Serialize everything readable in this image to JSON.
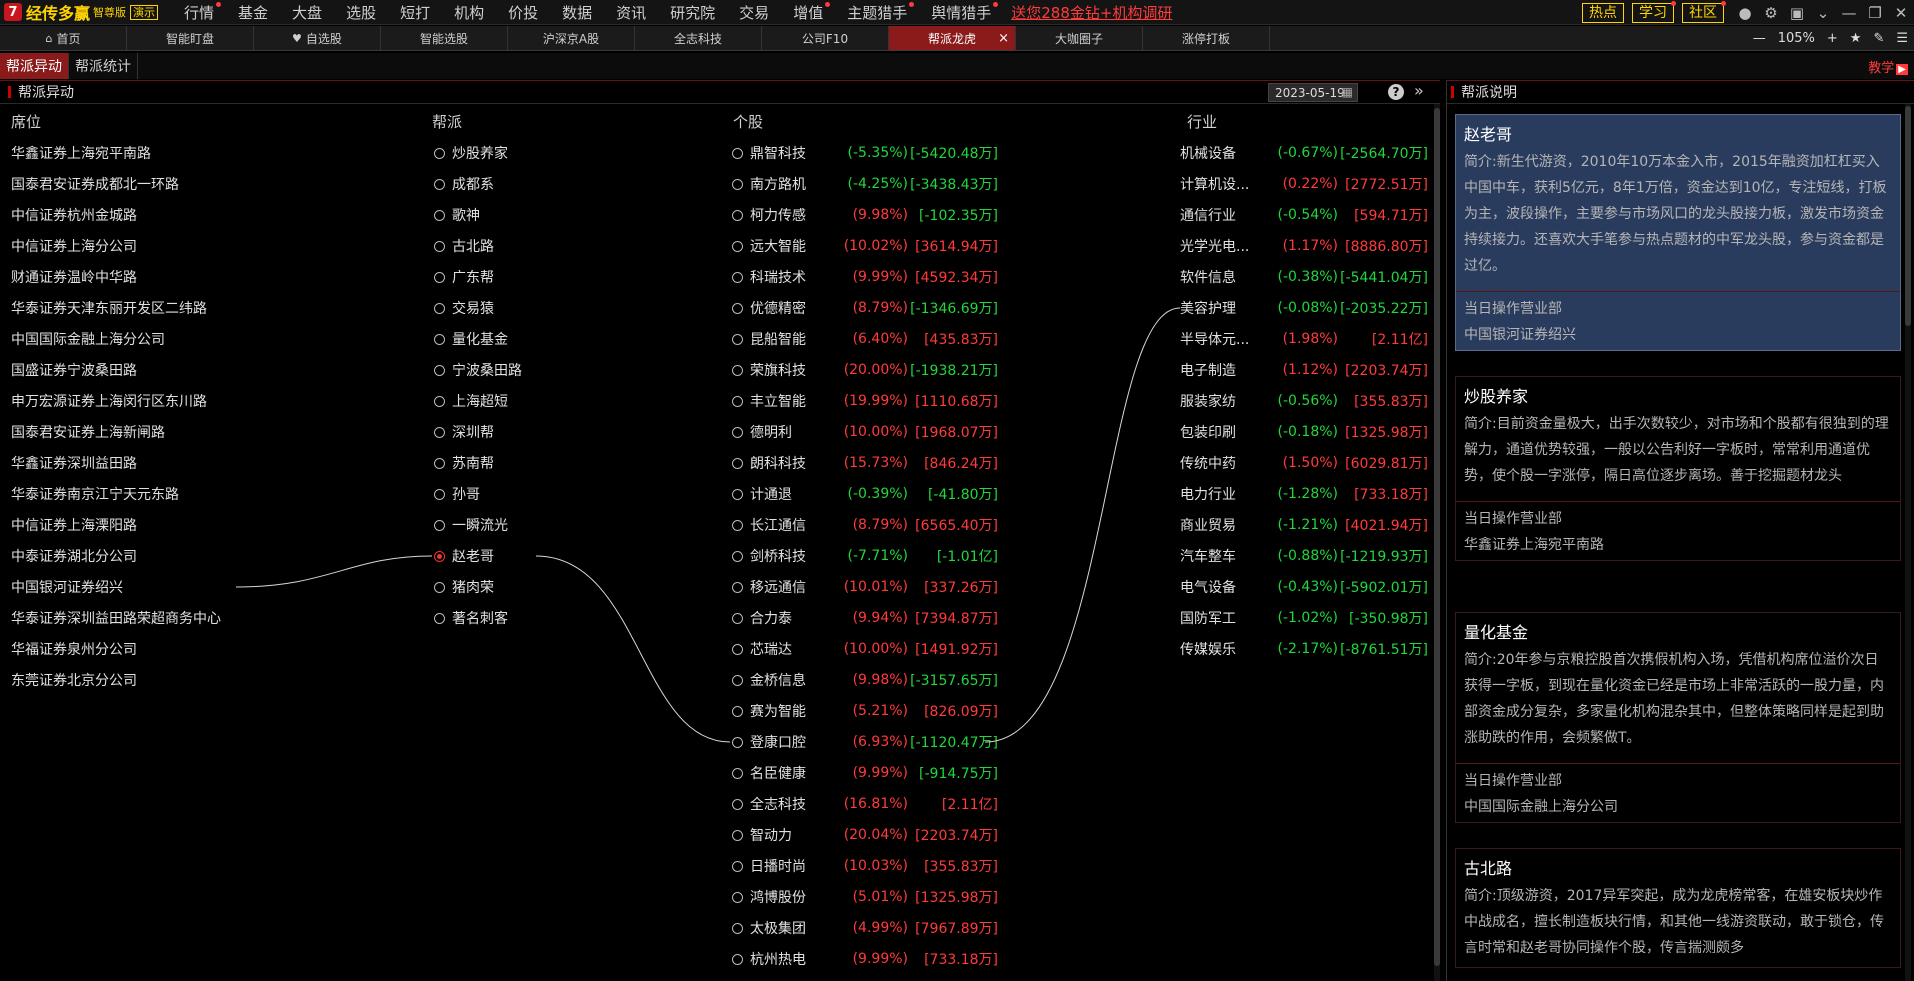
{
  "app": {
    "logo_mark": "7",
    "logo_text": "经传多赢",
    "logo_version": "智尊版",
    "logo_demo": "演示"
  },
  "menu": [
    {
      "label": "行情",
      "dot": true
    },
    {
      "label": "基金",
      "dot": false
    },
    {
      "label": "大盘",
      "dot": false
    },
    {
      "label": "选股",
      "dot": false
    },
    {
      "label": "短打",
      "dot": false
    },
    {
      "label": "机构",
      "dot": false
    },
    {
      "label": "价投",
      "dot": false
    },
    {
      "label": "数据",
      "dot": false
    },
    {
      "label": "资讯",
      "dot": false
    },
    {
      "label": "研究院",
      "dot": false
    },
    {
      "label": "交易",
      "dot": false
    },
    {
      "label": "增值",
      "dot": true
    },
    {
      "label": "主题猎手",
      "dot": true
    },
    {
      "label": "舆情猎手",
      "dot": true
    }
  ],
  "promo": "送您288金钻+机构调研",
  "top_buttons": [
    "热点",
    "学习",
    "社区"
  ],
  "tabs": [
    {
      "label": "首页",
      "icon": "home-icon"
    },
    {
      "label": "智能盯盘"
    },
    {
      "label": "自选股",
      "icon": "heart-icon"
    },
    {
      "label": "智能选股"
    },
    {
      "label": "沪深京A股"
    },
    {
      "label": "全志科技"
    },
    {
      "label": "公司F10"
    },
    {
      "label": "帮派龙虎",
      "active": true
    },
    {
      "label": "大咖圈子"
    },
    {
      "label": "涨停打板"
    }
  ],
  "zoom": "105%",
  "subtabs": [
    "帮派异动",
    "帮派统计"
  ],
  "teach_label": "教学",
  "panel": {
    "title": "帮派异动",
    "date": "2023-05-19"
  },
  "columns": {
    "seat": "席位",
    "gang": "帮派",
    "stock": "个股",
    "industry": "行业"
  },
  "seats": [
    "华鑫证券上海宛平南路",
    "国泰君安证券成都北一环路",
    "中信证券杭州金城路",
    "中信证券上海分公司",
    "财通证券温岭中华路",
    "华泰证券天津东丽开发区二纬路",
    "中国国际金融上海分公司",
    "国盛证券宁波桑田路",
    "申万宏源证券上海闵行区东川路",
    "国泰君安证券上海新闸路",
    "华鑫证券深圳益田路",
    "华泰证券南京江宁天元东路",
    "中信证券上海溧阳路",
    "中泰证券湖北分公司",
    "中国银河证券绍兴",
    "华泰证券深圳益田路荣超商务中心",
    "华福证券泉州分公司",
    "东莞证券北京分公司"
  ],
  "gangs": [
    {
      "name": "炒股养家",
      "selected": false
    },
    {
      "name": "成都系",
      "selected": false
    },
    {
      "name": "歌神",
      "selected": false
    },
    {
      "name": "古北路",
      "selected": false
    },
    {
      "name": "广东帮",
      "selected": false
    },
    {
      "name": "交易猿",
      "selected": false
    },
    {
      "name": "量化基金",
      "selected": false
    },
    {
      "name": "宁波桑田路",
      "selected": false
    },
    {
      "name": "上海超短",
      "selected": false
    },
    {
      "name": "深圳帮",
      "selected": false
    },
    {
      "name": "苏南帮",
      "selected": false
    },
    {
      "name": "孙哥",
      "selected": false
    },
    {
      "name": "一瞬流光",
      "selected": false
    },
    {
      "name": "赵老哥",
      "selected": true
    },
    {
      "name": "猪肉荣",
      "selected": false
    },
    {
      "name": "著名刺客",
      "selected": false
    }
  ],
  "stocks": [
    {
      "name": "鼎智科技",
      "pct": "(-5.35%)",
      "amt": "[-5420.48万]",
      "pct_up": false,
      "amt_up": false
    },
    {
      "name": "南方路机",
      "pct": "(-4.25%)",
      "amt": "[-3438.43万]",
      "pct_up": false,
      "amt_up": false
    },
    {
      "name": "柯力传感",
      "pct": "(9.98%)",
      "amt": "[-102.35万]",
      "pct_up": true,
      "amt_up": false
    },
    {
      "name": "远大智能",
      "pct": "(10.02%)",
      "amt": "[3614.94万]",
      "pct_up": true,
      "amt_up": true
    },
    {
      "name": "科瑞技术",
      "pct": "(9.99%)",
      "amt": "[4592.34万]",
      "pct_up": true,
      "amt_up": true
    },
    {
      "name": "优德精密",
      "pct": "(8.79%)",
      "amt": "[-1346.69万]",
      "pct_up": true,
      "amt_up": false
    },
    {
      "name": "昆船智能",
      "pct": "(6.40%)",
      "amt": "[435.83万]",
      "pct_up": true,
      "amt_up": true
    },
    {
      "name": "荣旗科技",
      "pct": "(20.00%)",
      "amt": "[-1938.21万]",
      "pct_up": true,
      "amt_up": false
    },
    {
      "name": "丰立智能",
      "pct": "(19.99%)",
      "amt": "[1110.68万]",
      "pct_up": true,
      "amt_up": true
    },
    {
      "name": "德明利",
      "pct": "(10.00%)",
      "amt": "[1968.07万]",
      "pct_up": true,
      "amt_up": true
    },
    {
      "name": "朗科科技",
      "pct": "(15.73%)",
      "amt": "[846.24万]",
      "pct_up": true,
      "amt_up": true
    },
    {
      "name": "计通退",
      "pct": "(-0.39%)",
      "amt": "[-41.80万]",
      "pct_up": false,
      "amt_up": false
    },
    {
      "name": "长江通信",
      "pct": "(8.79%)",
      "amt": "[6565.40万]",
      "pct_up": true,
      "amt_up": true
    },
    {
      "name": "剑桥科技",
      "pct": "(-7.71%)",
      "amt": "[-1.01亿]",
      "pct_up": false,
      "amt_up": false
    },
    {
      "name": "移远通信",
      "pct": "(10.01%)",
      "amt": "[337.26万]",
      "pct_up": true,
      "amt_up": true
    },
    {
      "name": "合力泰",
      "pct": "(9.94%)",
      "amt": "[7394.87万]",
      "pct_up": true,
      "amt_up": true
    },
    {
      "name": "芯瑞达",
      "pct": "(10.00%)",
      "amt": "[1491.92万]",
      "pct_up": true,
      "amt_up": true
    },
    {
      "name": "金桥信息",
      "pct": "(9.98%)",
      "amt": "[-3157.65万]",
      "pct_up": true,
      "amt_up": false
    },
    {
      "name": "赛为智能",
      "pct": "(5.21%)",
      "amt": "[826.09万]",
      "pct_up": true,
      "amt_up": true
    },
    {
      "name": "登康口腔",
      "pct": "(6.93%)",
      "amt": "[-1120.47万]",
      "pct_up": true,
      "amt_up": false
    },
    {
      "name": "名臣健康",
      "pct": "(9.99%)",
      "amt": "[-914.75万]",
      "pct_up": true,
      "amt_up": false
    },
    {
      "name": "全志科技",
      "pct": "(16.81%)",
      "amt": "[2.11亿]",
      "pct_up": true,
      "amt_up": true
    },
    {
      "name": "智动力",
      "pct": "(20.04%)",
      "amt": "[2203.74万]",
      "pct_up": true,
      "amt_up": true
    },
    {
      "name": "日播时尚",
      "pct": "(10.03%)",
      "amt": "[355.83万]",
      "pct_up": true,
      "amt_up": true
    },
    {
      "name": "鸿博股份",
      "pct": "(5.01%)",
      "amt": "[1325.98万]",
      "pct_up": true,
      "amt_up": true
    },
    {
      "name": "太极集团",
      "pct": "(4.99%)",
      "amt": "[7967.89万]",
      "pct_up": true,
      "amt_up": true
    },
    {
      "name": "杭州热电",
      "pct": "(9.99%)",
      "amt": "[733.18万]",
      "pct_up": true,
      "amt_up": true
    }
  ],
  "industries": [
    {
      "name": "机械设备",
      "pct": "(-0.67%)",
      "amt": "[-2564.70万]",
      "pct_up": false,
      "amt_up": false
    },
    {
      "name": "计算机设...",
      "pct": "(0.22%)",
      "amt": "[2772.51万]",
      "pct_up": true,
      "amt_up": true
    },
    {
      "name": "通信行业",
      "pct": "(-0.54%)",
      "amt": "[594.71万]",
      "pct_up": false,
      "amt_up": true
    },
    {
      "name": "光学光电...",
      "pct": "(1.17%)",
      "amt": "[8886.80万]",
      "pct_up": true,
      "amt_up": true
    },
    {
      "name": "软件信息",
      "pct": "(-0.38%)",
      "amt": "[-5441.04万]",
      "pct_up": false,
      "amt_up": false
    },
    {
      "name": "美容护理",
      "pct": "(-0.08%)",
      "amt": "[-2035.22万]",
      "pct_up": false,
      "amt_up": false
    },
    {
      "name": "半导体元...",
      "pct": "(1.98%)",
      "amt": "[2.11亿]",
      "pct_up": true,
      "amt_up": true
    },
    {
      "name": "电子制造",
      "pct": "(1.12%)",
      "amt": "[2203.74万]",
      "pct_up": true,
      "amt_up": true
    },
    {
      "name": "服装家纺",
      "pct": "(-0.56%)",
      "amt": "[355.83万]",
      "pct_up": false,
      "amt_up": true
    },
    {
      "name": "包装印刷",
      "pct": "(-0.18%)",
      "amt": "[1325.98万]",
      "pct_up": false,
      "amt_up": true
    },
    {
      "name": "传统中药",
      "pct": "(1.50%)",
      "amt": "[6029.81万]",
      "pct_up": true,
      "amt_up": true
    },
    {
      "name": "电力行业",
      "pct": "(-1.28%)",
      "amt": "[733.18万]",
      "pct_up": false,
      "amt_up": true
    },
    {
      "name": "商业贸易",
      "pct": "(-1.21%)",
      "amt": "[4021.94万]",
      "pct_up": false,
      "amt_up": true
    },
    {
      "name": "汽车整车",
      "pct": "(-0.88%)",
      "amt": "[-1219.93万]",
      "pct_up": false,
      "amt_up": false
    },
    {
      "name": "电气设备",
      "pct": "(-0.43%)",
      "amt": "[-5902.01万]",
      "pct_up": false,
      "amt_up": false
    },
    {
      "name": "国防军工",
      "pct": "(-1.02%)",
      "amt": "[-350.98万]",
      "pct_up": false,
      "amt_up": false
    },
    {
      "name": "传媒娱乐",
      "pct": "(-2.17%)",
      "amt": "[-8761.51万]",
      "pct_up": false,
      "amt_up": false
    }
  ],
  "right_panel": {
    "title": "帮派说明",
    "op_label": "当日操作营业部",
    "cards": [
      {
        "name": "赵老哥",
        "desc": "简介:新生代游资，2010年10万本金入市，2015年融资加杠杠买入中国中车，获利5亿元，8年1万倍，资金达到10亿，专注短线，打板为主，波段操作，主要参与市场风口的龙头股接力板，激发市场资金持续接力。还喜欢大手笔参与热点题材的中军龙头股，参与资金都是过亿。",
        "dept": "中国银河证券绍兴",
        "selected": true
      },
      {
        "name": "炒股养家",
        "desc": "简介:目前资金量极大，出手次数较少，对市场和个股都有很独到的理解力，通道优势较强，一般以公告利好一字板时，常常利用通道优势，使个股一字涨停，隔日高位逐步离场。善于挖掘题材龙头",
        "dept": "华鑫证券上海宛平南路",
        "selected": false
      },
      {
        "name": "量化基金",
        "desc": "简介:20年参与京粮控股首次携假机构入场，凭借机构席位溢价次日获得一字板，到现在量化资金已经是市场上非常活跃的一股力量，内部资金成分复杂，多家量化机构混杂其中，但整体策略同样是起到助涨助跌的作用，会频繁做T。",
        "dept": "中国国际金融上海分公司",
        "selected": false
      },
      {
        "name": "古北路",
        "desc": "简介:顶级游资，2017异军突起，成为龙虎榜常客，在雄安板块炒作中战成名，擅长制造板块行情，和其他一线游资联动，敢于锁仓，传言时常和赵老哥协同操作个股，传言揣测颇多",
        "dept": "",
        "selected": false
      }
    ]
  }
}
